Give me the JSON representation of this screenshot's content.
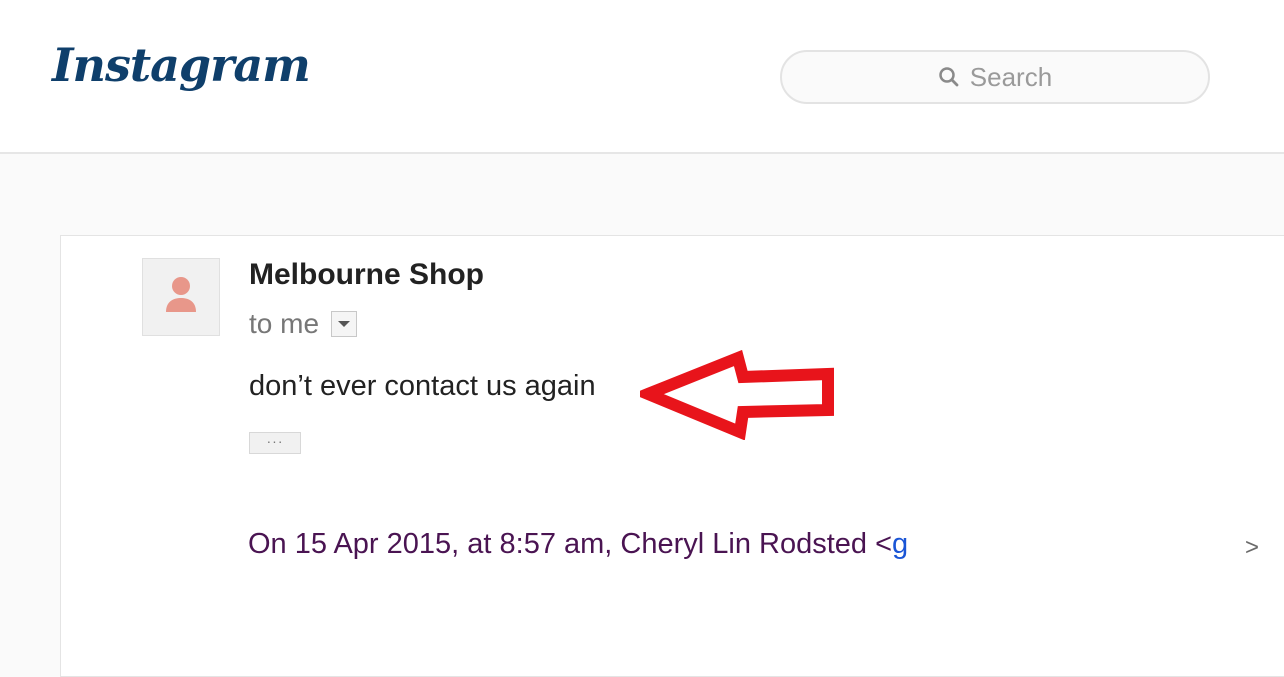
{
  "header": {
    "logo_text": "Instagram",
    "search_placeholder": "Search"
  },
  "email": {
    "sender": "Melbourne Shop",
    "recipient": "to me",
    "body": "don’t ever contact us again",
    "ellipsis": "···",
    "quote_prefix": "On 15 Apr 2015, at 8:57 am, Cheryl Lin Rodsted <",
    "quote_link_fragment": "g",
    "quote_suffix": ">"
  },
  "colors": {
    "logo": "#0f3f6b",
    "annotation_arrow": "#e8141b",
    "avatar_icon": "#e8978a",
    "quote_text": "#4a1452"
  },
  "icons": {
    "search": "search-icon",
    "avatar": "person-icon",
    "dropdown": "caret-down-icon",
    "annotation": "left-arrow-annotation-icon"
  }
}
